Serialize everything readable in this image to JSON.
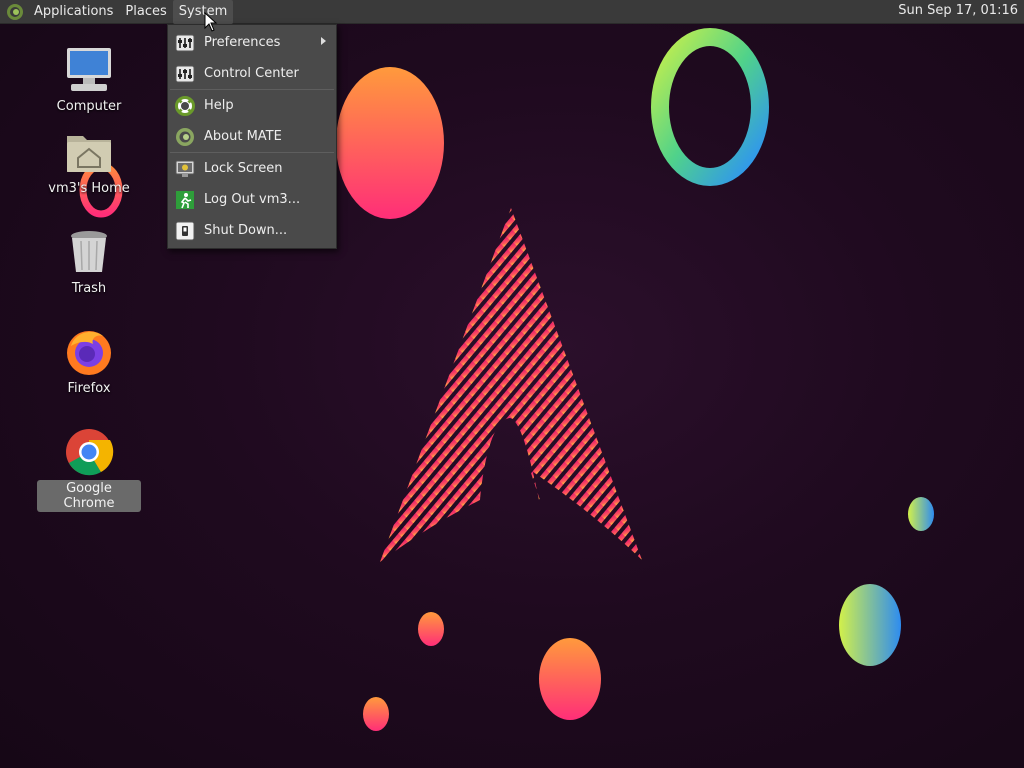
{
  "panel": {
    "menus": [
      "Applications",
      "Places",
      "System"
    ],
    "clock": "Sun Sep 17, 01:16"
  },
  "system_menu": {
    "items": [
      {
        "label": "Preferences",
        "icon": "preferences-icon",
        "submenu": true
      },
      {
        "label": "Control Center",
        "icon": "control-center-icon"
      },
      {
        "label": "Help",
        "icon": "help-lifebuoy-icon"
      },
      {
        "label": "About MATE",
        "icon": "mate-logo-icon"
      },
      {
        "label": "Lock Screen",
        "icon": "lock-screen-icon"
      },
      {
        "label": "Log Out vm3...",
        "icon": "logout-exit-icon"
      },
      {
        "label": "Shut Down...",
        "icon": "shutdown-icon"
      }
    ]
  },
  "desktop": {
    "icons": [
      {
        "label": "Computer",
        "icon": "computer-icon"
      },
      {
        "label": "vm3's Home",
        "icon": "home-folder-icon"
      },
      {
        "label": "Trash",
        "icon": "trash-icon"
      },
      {
        "label": "Firefox",
        "icon": "firefox-icon"
      },
      {
        "label": "Google Chrome",
        "icon": "chrome-icon",
        "selected": true
      }
    ]
  },
  "colors": {
    "panel": "#3a3a3a",
    "menu": "#4a4a4a",
    "wallpaper": "#1f0a1f",
    "accent_pink": "#e8306e",
    "accent_orange": "#ff8a3d"
  }
}
